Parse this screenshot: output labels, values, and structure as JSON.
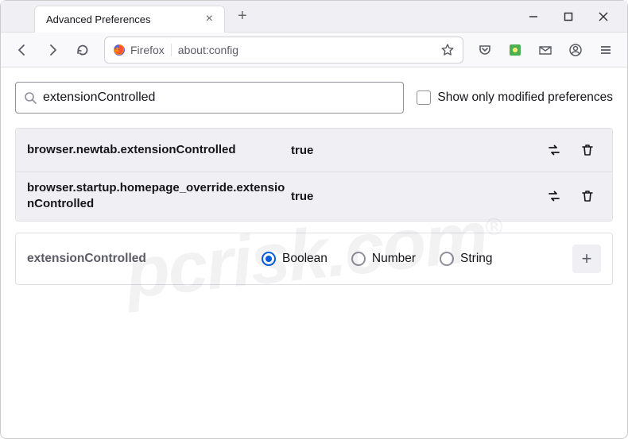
{
  "window": {
    "tab_title": "Advanced Preferences"
  },
  "toolbar": {
    "identity_label": "Firefox",
    "url": "about:config"
  },
  "search": {
    "value": "extensionControlled",
    "placeholder": "",
    "checkbox_label": "Show only modified preferences"
  },
  "prefs": [
    {
      "name": "browser.newtab.extensionControlled",
      "value": "true"
    },
    {
      "name": "browser.startup.homepage_override.extensionControlled",
      "value": "true"
    }
  ],
  "new_pref": {
    "name": "extensionControlled",
    "types": [
      "Boolean",
      "Number",
      "String"
    ],
    "selected": "Boolean"
  },
  "watermark": "pcrisk.com"
}
